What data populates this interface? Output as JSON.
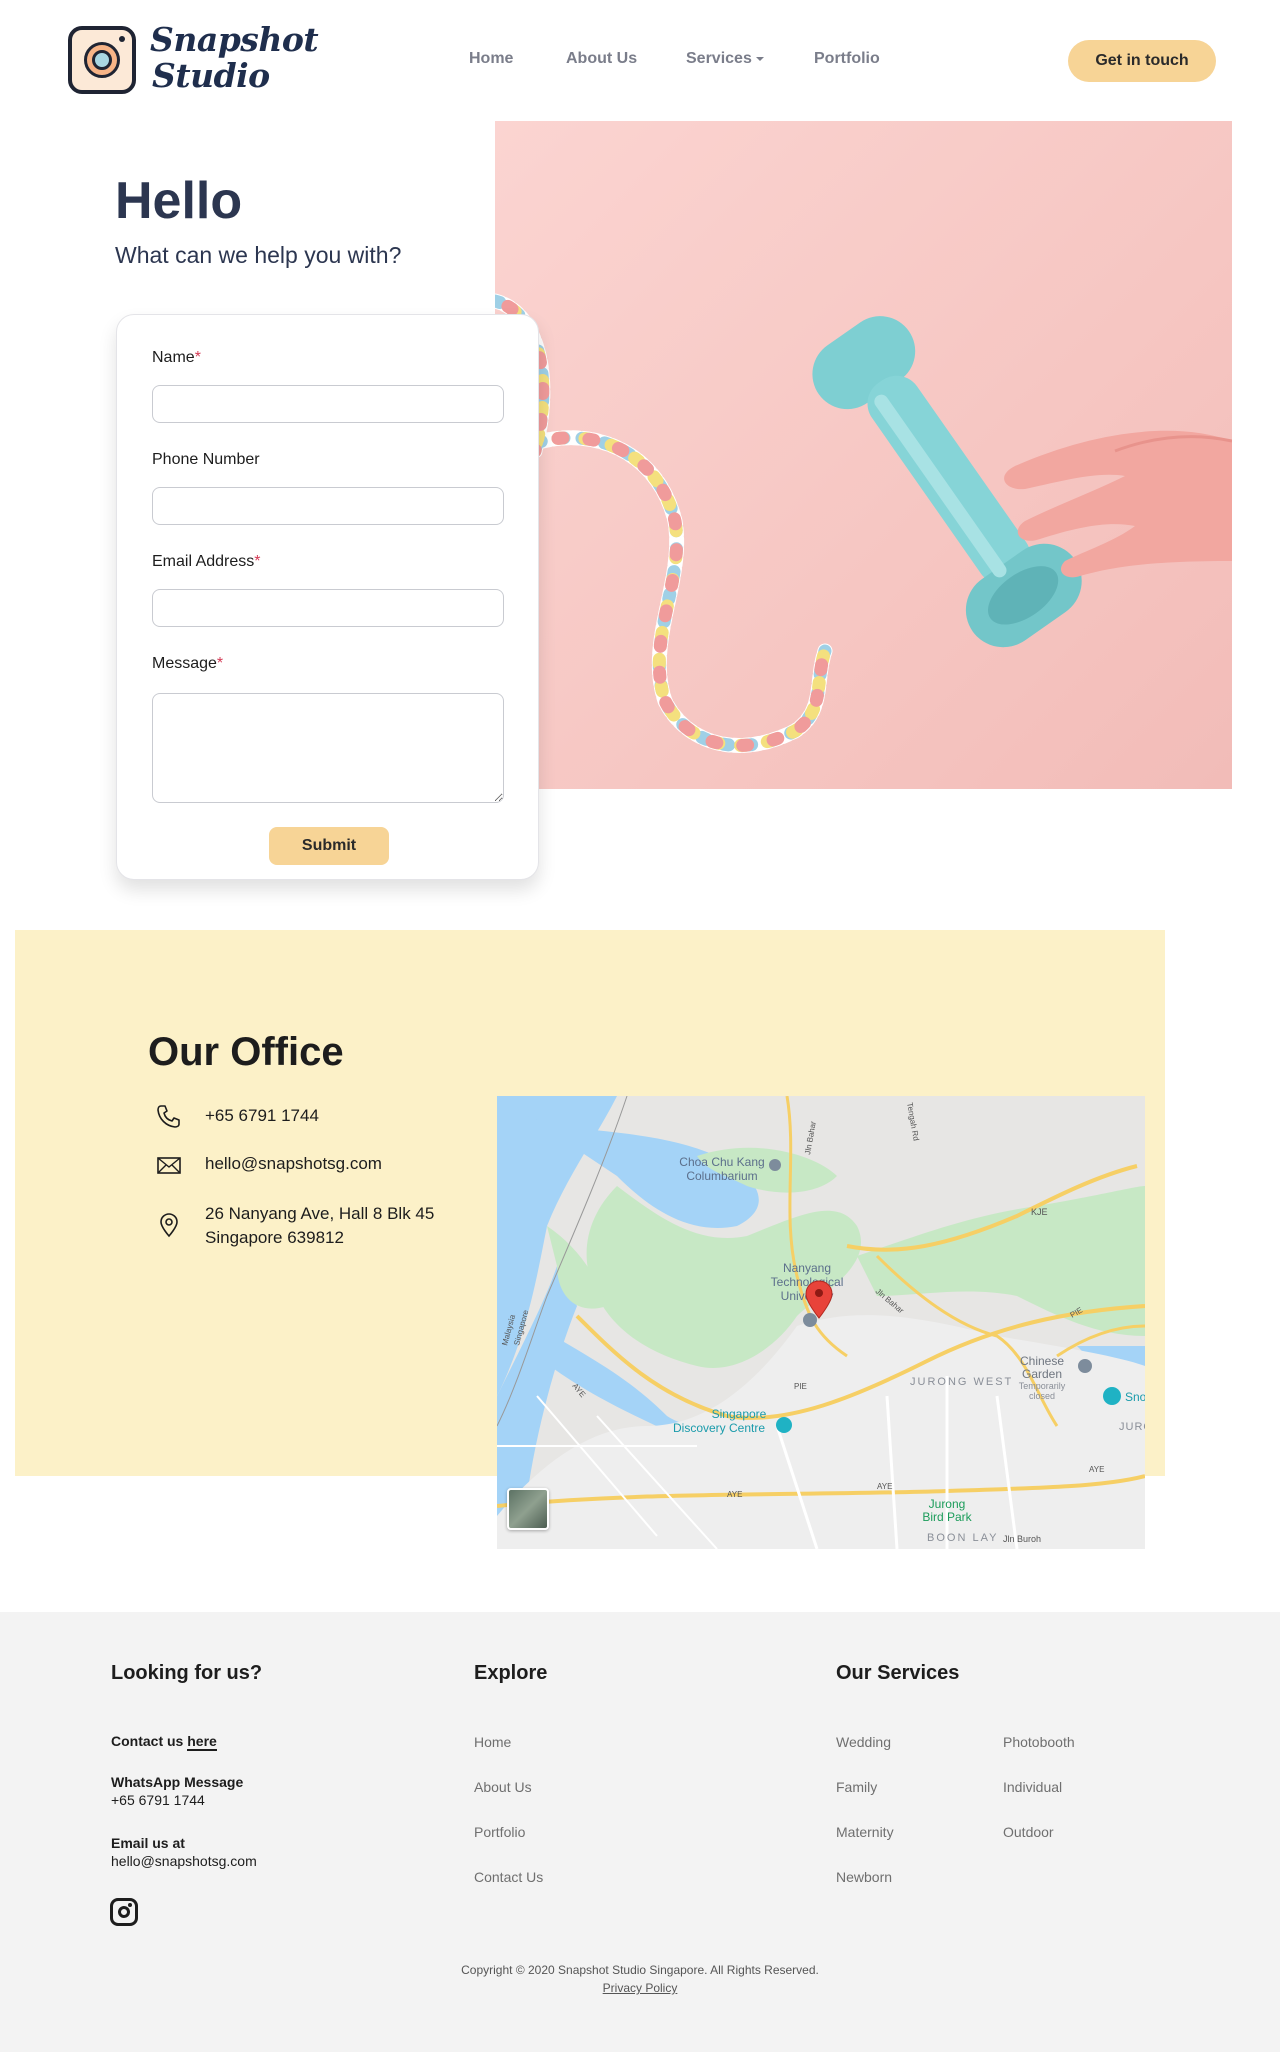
{
  "header": {
    "brand_line1": "Snapshot",
    "brand_line2": "Studio",
    "nav": [
      "Home",
      "About Us",
      "Services",
      "Portfolio"
    ],
    "cta": "Get in touch"
  },
  "hero": {
    "title": "Hello",
    "subtitle": "What can we help you with?"
  },
  "form": {
    "name_label": "Name",
    "phone_label": "Phone Number",
    "email_label": "Email Address",
    "message_label": "Message",
    "required_mark": "*",
    "submit": "Submit"
  },
  "office": {
    "title": "Our Office",
    "phone": "+65 6791 1744",
    "email": "hello@snapshotsg.com",
    "address_line1": "26 Nanyang Ave, Hall 8 Blk 45",
    "address_line2": "Singapore 639812"
  },
  "map": {
    "labels": {
      "choa1": "Choa Chu Kang",
      "choa2": "Columbarium",
      "ntu1": "Nanyang",
      "ntu2": "Technological",
      "ntu3": "University",
      "sdc1": "Singapore",
      "sdc2": "Discovery Centre",
      "jw": "JURONG WEST",
      "cg1": "Chinese",
      "cg2": "Garden",
      "cg3": "Temporarily",
      "cg4": "closed",
      "jbp1": "Jurong",
      "jbp2": "Bird Park",
      "bl": "BOON LAY",
      "sn": "Sno",
      "juro": "JURO",
      "kje": "KJE",
      "pie1": "PIE",
      "pie2": "PIE",
      "aye1": "AYE",
      "aye2": "AYE",
      "aye3": "AYE",
      "aye4": "AYE",
      "jlnbahar1": "Jln Bahar",
      "jlnbahar2": "Jln Bahar",
      "jlnburoh": "Jln Buroh",
      "tengah": "Tengah Rd",
      "mal1": "Malaysia",
      "mal2": "Singapore"
    }
  },
  "footer": {
    "col1_title": "Looking for us?",
    "contact_prefix": "Contact us",
    "contact_link": "here",
    "wa_title": "WhatsApp Message",
    "wa_number": "+65 6791 1744",
    "email_title": "Email us at",
    "email": "hello@snapshotsg.com",
    "col2_title": "Explore",
    "explore": [
      "Home",
      "About Us",
      "Portfolio",
      "Contact Us"
    ],
    "col3_title": "Our Services",
    "services_a": [
      "Wedding",
      "Family",
      "Maternity",
      "Newborn"
    ],
    "services_b": [
      "Photobooth",
      "Individual",
      "Outdoor"
    ],
    "copyright": "Copyright © 2020 Snapshot Studio Singapore. All Rights Reserved.",
    "privacy": "Privacy Policy"
  },
  "colors": {
    "accent": "#f7d496",
    "office_bg": "#fcf1c8",
    "hero_bg": "#f6c6c2",
    "text_dark": "#2c3650",
    "required": "#d43a55"
  },
  "icons": [
    "phone-icon",
    "mail-icon",
    "location-pin-icon",
    "instagram-icon",
    "map-marker-icon"
  ]
}
